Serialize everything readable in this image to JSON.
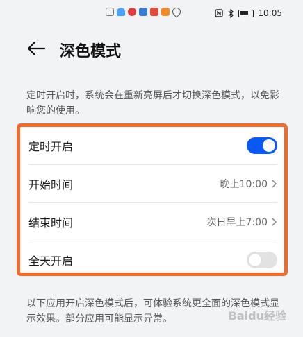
{
  "statusbar": {
    "time": "10:05",
    "icons": [
      "nfc-icon",
      "bluetooth-icon",
      "battery-icon"
    ],
    "left_icons": [
      "sim-icon",
      "wifi-icon",
      "huawei-icon",
      "cloud-icon",
      "app-icon",
      "play-icon",
      "location-icon"
    ],
    "left_colors": [
      "#777777",
      "#4aa1ff",
      "#e23b3b",
      "#3a7bd5",
      "#e34a3a",
      "#f08b2a",
      "#555555"
    ]
  },
  "header": {
    "back_icon": "back-arrow-icon",
    "title": "深色模式"
  },
  "description": "定时开启时，系统会在重新亮屏后才切换深色模式，以免影响您的使用。",
  "settings": {
    "scheduled": {
      "label": "定时开启",
      "enabled": true
    },
    "start_time": {
      "label": "开始时间",
      "value": "晚上10:00"
    },
    "end_time": {
      "label": "结束时间",
      "value": "次日早上7:00"
    },
    "all_day": {
      "label": "全天开启",
      "enabled": false
    }
  },
  "footer": "以下应用开启深色模式后，可体验系统更全面的深色模式显示效果。部分应用可能显示异常。",
  "watermark": "Baidu经验",
  "colors": {
    "accent": "#0a59f7",
    "highlight_border": "#f06a2e"
  }
}
